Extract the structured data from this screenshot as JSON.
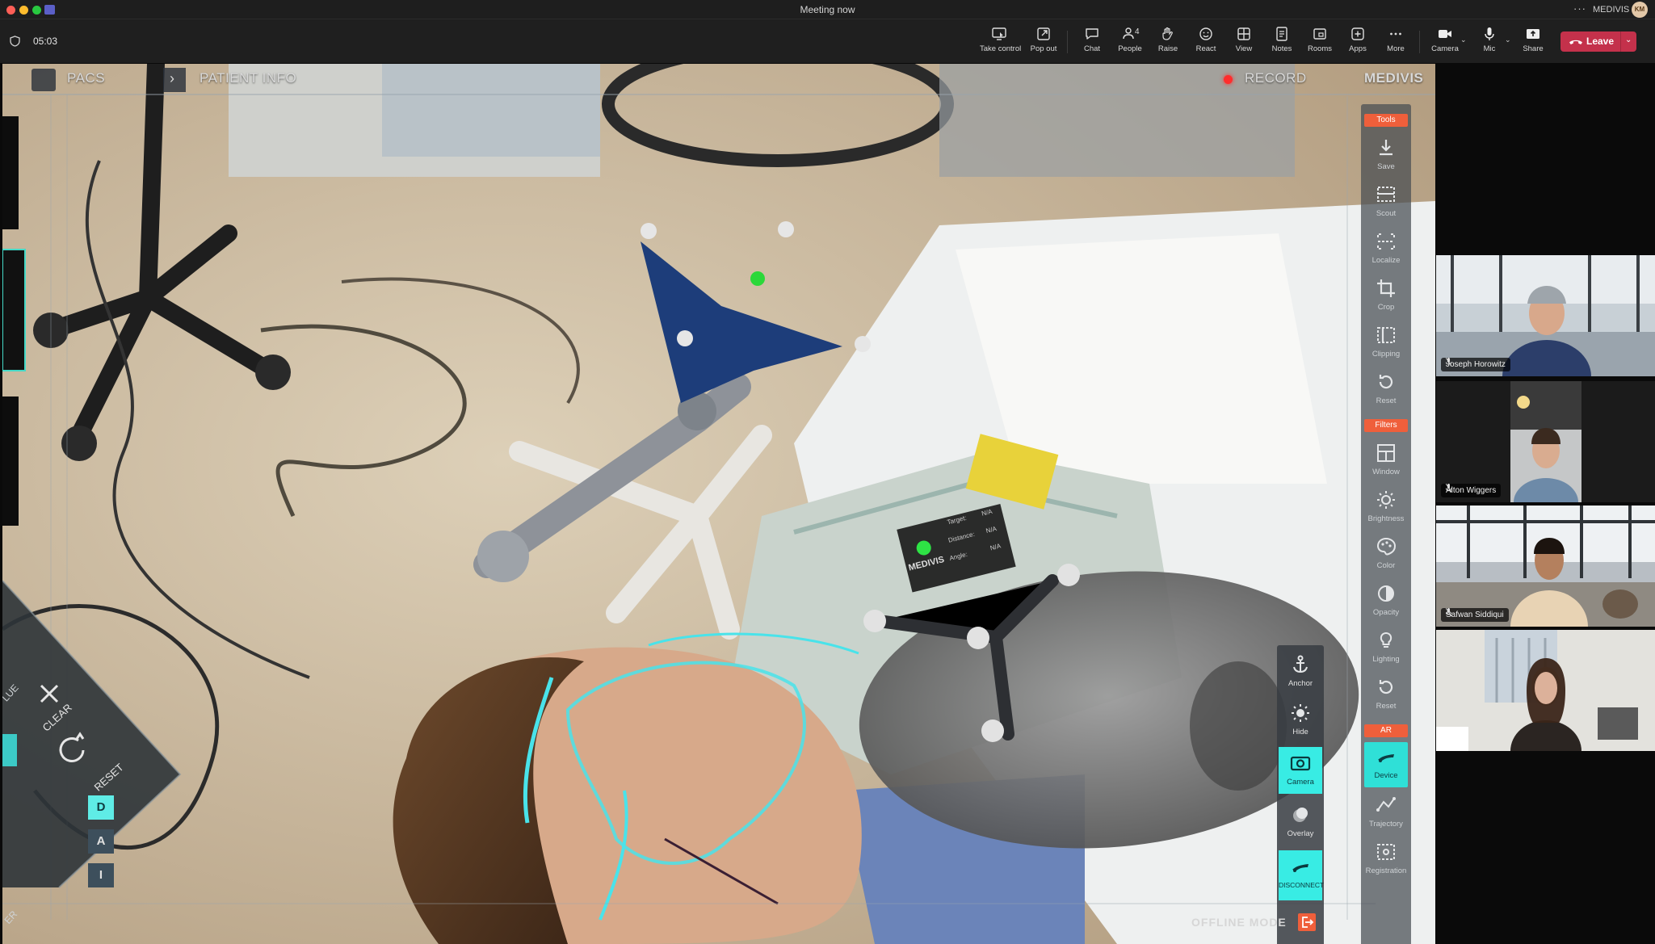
{
  "window": {
    "title": "Meeting now",
    "more_glyph": "···",
    "org_name": "MEDIVIS",
    "avatar_initials": "KM"
  },
  "toolbar": {
    "timer": "05:03",
    "take_control": "Take control",
    "pop_out": "Pop out",
    "chat": "Chat",
    "people": "People",
    "people_count": "4",
    "raise": "Raise",
    "react": "React",
    "view": "View",
    "notes": "Notes",
    "rooms": "Rooms",
    "apps": "Apps",
    "more": "More",
    "camera": "Camera",
    "mic": "Mic",
    "share": "Share",
    "leave": "Leave",
    "leave_color": "#c4314b"
  },
  "ar": {
    "pacs": "PACS",
    "patient_info": "PATIENT INFO",
    "record": "RECORD",
    "brand": "MEDIVIS",
    "accent_color": "#2fe0d7",
    "header_color": "#ef5f3b",
    "sections": {
      "tools": "Tools",
      "filters": "Filters",
      "ar": "AR"
    },
    "tools": [
      "Save",
      "Scout",
      "Localize",
      "Crop",
      "Clipping",
      "Reset"
    ],
    "filters": [
      "Window",
      "Brightness",
      "Color",
      "Opacity",
      "Lighting",
      "Reset"
    ],
    "ar_tools": [
      "Device",
      "Trajectory",
      "Registration"
    ],
    "ar_panel": [
      "Anchor",
      "Hide",
      "Camera",
      "Overlay",
      "DISCONNECT"
    ],
    "left_panel": {
      "clear": "CLEAR",
      "reset": "RESET",
      "edge_top": "LUE",
      "edge_bottom": "ER",
      "d": "D",
      "a": "A",
      "i": "I"
    },
    "tracker_brand": "MEDIVIS",
    "tracker_fields": [
      "Target:",
      "Distance:",
      "Angle:"
    ],
    "tracker_values": [
      "N/A",
      "N/A",
      "N/A"
    ],
    "offline_mode": "OFFLINE MODE"
  },
  "participants": [
    {
      "name": "Joseph Horowitz",
      "muted": true
    },
    {
      "name": "Alton Wiggers",
      "muted": true
    },
    {
      "name": "Safwan Siddiqui",
      "muted": true
    },
    {
      "name": "",
      "muted": false
    }
  ]
}
